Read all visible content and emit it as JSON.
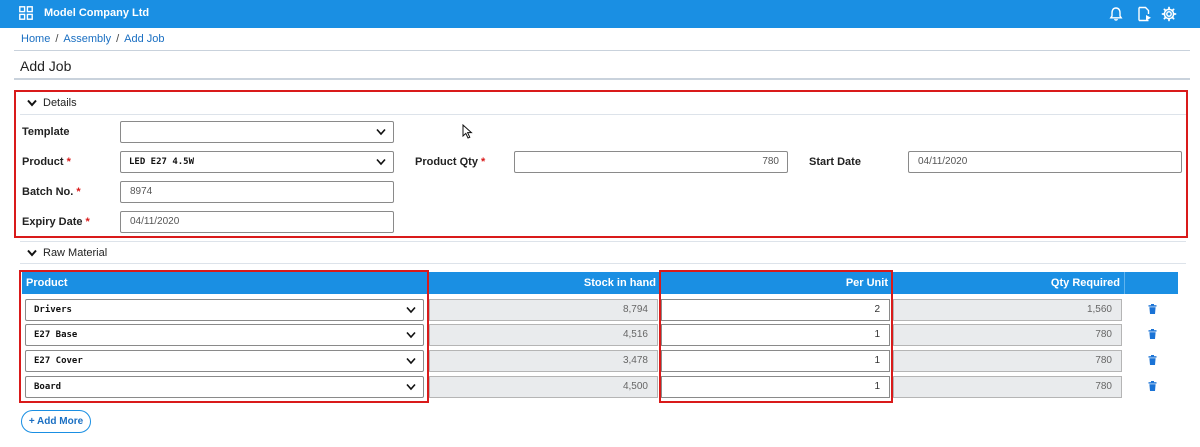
{
  "header": {
    "company": "Model Company Ltd",
    "brand_color": "#1a8fe3"
  },
  "breadcrumb": {
    "home": "Home",
    "assembly": "Assembly",
    "current": "Add Job",
    "separator": "/"
  },
  "page": {
    "title": "Add Job"
  },
  "details": {
    "section_label": "Details",
    "template": {
      "label": "Template",
      "value": ""
    },
    "product": {
      "label": "Product",
      "value": "LED E27 4.5W"
    },
    "product_qty": {
      "label": "Product Qty",
      "value": "780"
    },
    "start_date": {
      "label": "Start Date",
      "value": "04/11/2020"
    },
    "batch_no": {
      "label": "Batch No.",
      "value": "8974"
    },
    "expiry_date": {
      "label": "Expiry Date",
      "value": "04/11/2020"
    },
    "required_marker": "*"
  },
  "raw_material": {
    "section_label": "Raw Material",
    "columns": {
      "product": "Product",
      "stock": "Stock in hand",
      "per_unit": "Per Unit",
      "qty_required": "Qty Required"
    },
    "rows": [
      {
        "product": "Drivers",
        "stock": "8,794",
        "per_unit": "2",
        "qty_required": "1,560"
      },
      {
        "product": "E27 Base",
        "stock": "4,516",
        "per_unit": "1",
        "qty_required": "780"
      },
      {
        "product": "E27 Cover",
        "stock": "3,478",
        "per_unit": "1",
        "qty_required": "780"
      },
      {
        "product": "Board",
        "stock": "4,500",
        "per_unit": "1",
        "qty_required": "780"
      }
    ],
    "add_more_label": "+ Add More"
  },
  "icons": {
    "apps": "apps-grid-icon",
    "notifications": "bell-icon",
    "report": "document-play-icon",
    "settings": "gear-icon",
    "delete": "trash-icon",
    "dropdown": "chevron-down-icon",
    "collapse": "chevron-down-icon"
  }
}
